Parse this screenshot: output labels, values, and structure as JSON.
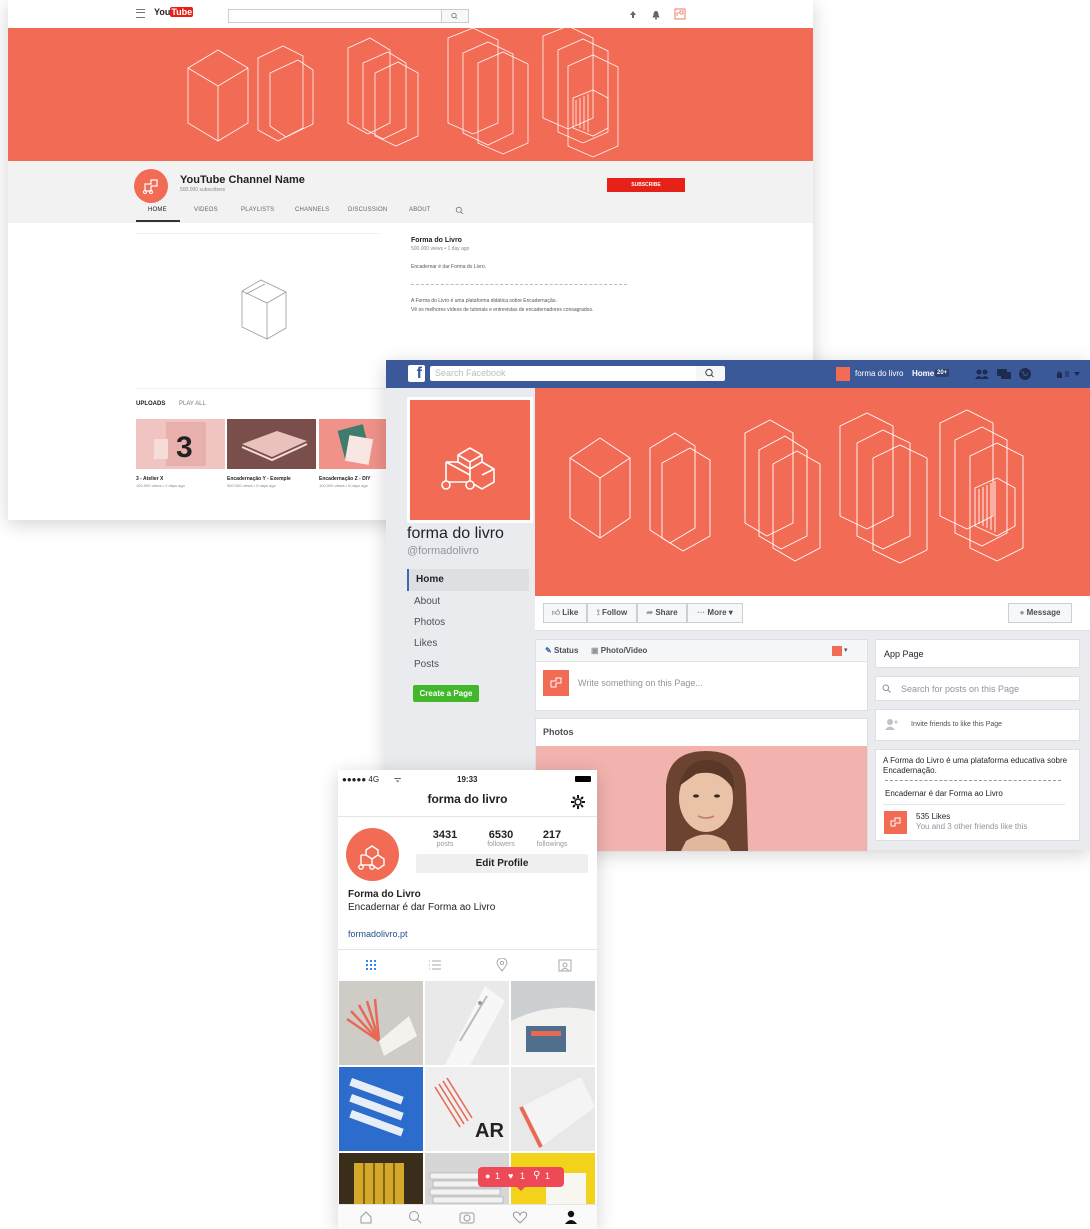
{
  "colors": {
    "coral": "#f26b55",
    "facebook_blue": "#3b5998",
    "subscribe_red": "#e62117",
    "create_green": "#42b72a"
  },
  "youtube": {
    "logo_text": "You",
    "logo_tube": "Tube",
    "channel_name": "YouTube Channel Name",
    "subscribers": "500.000 subscribers",
    "subscribe_label": "SUBSCRIBE",
    "tabs": [
      "HOME",
      "VIDEOS",
      "PLAYLISTS",
      "CHANNELS",
      "DISCUSSION",
      "ABOUT"
    ],
    "featured": {
      "title": "Forma do Livro",
      "meta": "500.000 views • 1 day ago",
      "tagline": "Encadernar é dar Forma do Livro.",
      "desc1": "A Forma do Livro é uma plataforma didática sobre Encadernação.",
      "desc2": "Vê os melhores vídeos de tutoriais e entrevistas de encadernadores consagrados."
    },
    "uploads_label": "UPLOADS",
    "play_all_label": "PLAY ALL",
    "videos": [
      {
        "title": "3 - Atelier X",
        "meta": "100.000 views • 2 days ago"
      },
      {
        "title": "Encadernação Y - Exemple",
        "meta": "300.000 views • 5 days ago"
      },
      {
        "title": "Encadernação Z - DIY",
        "meta": "100.000 views • 6 days ago"
      }
    ]
  },
  "facebook": {
    "search_placeholder": "Search Facebook",
    "user_name": "forma do livro",
    "home_label": "Home",
    "home_badge": "20+",
    "page_name": "forma do livro",
    "handle": "@formadolivro",
    "nav": [
      "Home",
      "About",
      "Photos",
      "Likes",
      "Posts"
    ],
    "create_page_label": "Create a Page",
    "actions": {
      "like": "Like",
      "follow": "Follow",
      "share": "Share",
      "more": "More",
      "message": "Message"
    },
    "composer": {
      "status": "Status",
      "photo_video": "Photo/Video",
      "placeholder": "Write something on this Page..."
    },
    "photos_label": "Photos",
    "app_page_label": "App Page",
    "search_posts_placeholder": "Search for posts on this Page",
    "invite_label": "Invite friends to like this Page",
    "about_text": "A Forma do Livro é uma plataforma educativa sobre Encadernação.",
    "about_tagline": "Encadernar é dar Forma ao Livro",
    "likes_count": "535 Likes",
    "likes_friends": "You and 3 other friends like this"
  },
  "instagram": {
    "carrier": "●●●●● 4G",
    "time": "19:33",
    "username": "forma do livro",
    "stats": [
      {
        "value": "3431",
        "label": "posts"
      },
      {
        "value": "6530",
        "label": "followers"
      },
      {
        "value": "217",
        "label": "followings"
      }
    ],
    "edit_profile_label": "Edit Profile",
    "bio_name": "Forma do Livro",
    "bio_text": "Encadernar é dar Forma ao Livro",
    "link": "formadolivro.pt",
    "notif": {
      "comments": "1",
      "likes": "1",
      "follows": "1"
    }
  }
}
